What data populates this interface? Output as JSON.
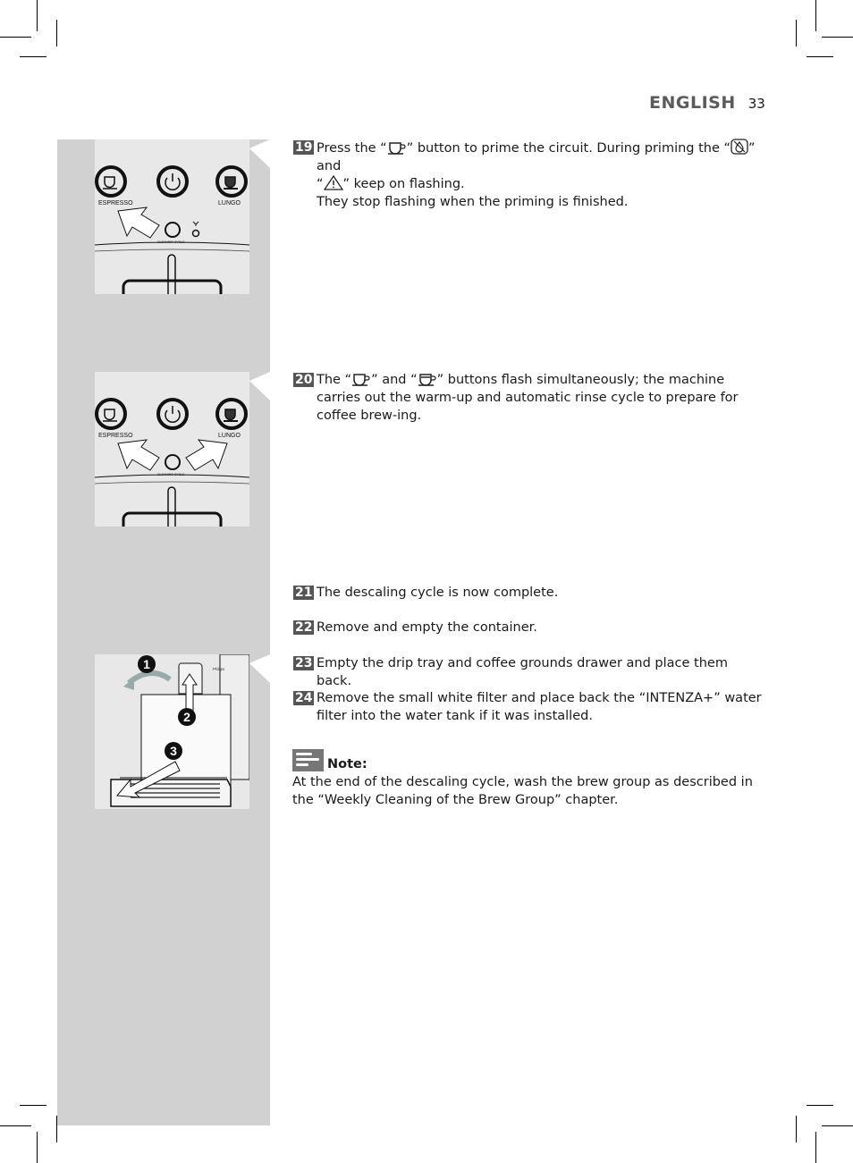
{
  "header": {
    "section": "ENGLISH",
    "page_number": "33"
  },
  "figures": [
    {
      "id": "fig-1",
      "labels": {
        "left_button": "ESPRESSO",
        "right_button": "LUNGO",
        "center_button": "CLEANING CYCLE"
      },
      "description": "Arrow points to Espresso button"
    },
    {
      "id": "fig-2",
      "labels": {
        "left_button": "ESPRESSO",
        "right_button": "LUNGO",
        "center_button": "CLEANING CYCLE"
      },
      "description": "Arrows point to Espresso and Lungo buttons"
    },
    {
      "id": "fig-3",
      "callouts": [
        "1",
        "2",
        "3"
      ],
      "brand_text": "Philips",
      "description": "Remove container, brew group door and drip tray"
    }
  ],
  "steps": [
    {
      "number": "19",
      "parts": [
        "Press the “",
        "” button to prime the circuit. During priming the “",
        "” and",
        "“",
        "” keep on flashing."
      ],
      "line3": "They stop flashing when the priming is finished.",
      "icons": [
        "espresso-cup-icon",
        "descale-icon",
        "warning-triangle-icon"
      ]
    },
    {
      "number": "20",
      "parts": [
        "The “",
        "” and “",
        "” buttons flash simultaneously; the machine carries out the warm-up and automatic rinse cycle to prepare for coffee brew-ing."
      ],
      "icons": [
        "espresso-cup-icon",
        "lungo-cup-icon"
      ]
    },
    {
      "number": "21",
      "text": "The descaling cycle is now complete."
    },
    {
      "number": "22",
      "text": "Remove and empty the container."
    },
    {
      "number": "23",
      "text": "Empty the drip tray and coffee grounds drawer and place them back."
    },
    {
      "number": "24",
      "text": "Remove the small white filter and place back the “INTENZA+” water filter into the water tank if it was installed."
    }
  ],
  "note": {
    "icon": "note-icon",
    "label": "Note:",
    "text": "At the end of the descaling cycle, wash the brew group as described in the “Weekly Cleaning of the Brew Group” chapter."
  }
}
